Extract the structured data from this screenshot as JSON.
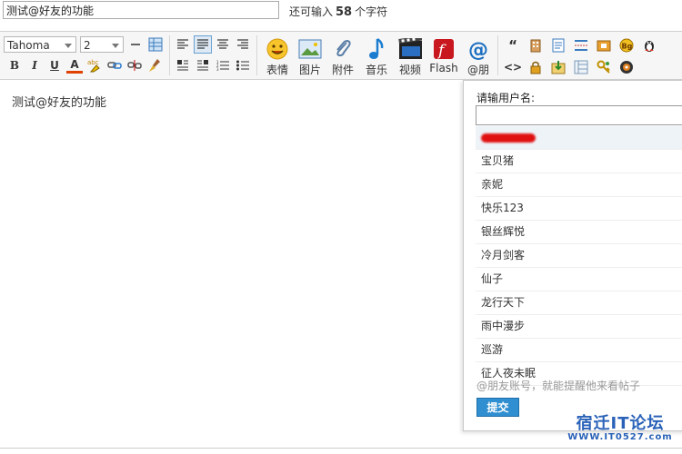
{
  "subject": {
    "value": "测试@好友的功能"
  },
  "counter": {
    "prefix": "还可输入",
    "count": "58",
    "suffix": "个字符"
  },
  "toolbar": {
    "font": "Tahoma",
    "size": "2",
    "buttons": {
      "bold": "B",
      "italic": "I",
      "underline": "U",
      "fontcolor": "A",
      "quote": "“",
      "code": "<>"
    },
    "big": [
      {
        "label": "表情",
        "icon": "smiley-icon"
      },
      {
        "label": "图片",
        "icon": "image-icon"
      },
      {
        "label": "附件",
        "icon": "paperclip-icon"
      },
      {
        "label": "音乐",
        "icon": "music-note-icon"
      },
      {
        "label": "视频",
        "icon": "film-icon"
      },
      {
        "label": "Flash",
        "icon": "flash-icon"
      },
      {
        "label": "@朋",
        "icon": "at-sign-icon"
      }
    ]
  },
  "editor": {
    "content": "测试@好友的功能"
  },
  "popup": {
    "label": "请输用户名:",
    "input_value": "",
    "items": [
      "",
      "宝贝猪",
      "亲妮",
      "快乐123",
      "银丝辉悦",
      "冷月剑客",
      "仙子",
      "龙行天下",
      "雨中漫步",
      "巡游",
      "征人夜未眠"
    ],
    "hint": "@朋友账号，就能提醒他来看帖子",
    "submit": "提交"
  },
  "watermark": {
    "line1": "宿迁IT论坛",
    "line2": "WWW.IT0527.com"
  }
}
